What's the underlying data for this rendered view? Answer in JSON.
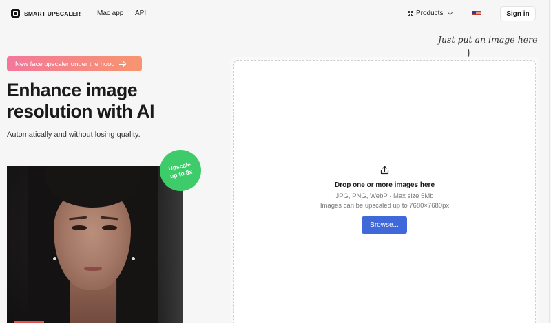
{
  "header": {
    "logo_text": "SMART UPSCALER",
    "nav": {
      "mac_app": "Mac app",
      "api": "API"
    },
    "products_label": "Products",
    "language_flag": "us-flag",
    "sign_in_label": "Sign in"
  },
  "hero": {
    "badge_text": "New face upscaler under the hood",
    "headline": "Enhance image resolution with AI",
    "subhead": "Automatically and without losing quality.",
    "stamp_text": "Upscale up to 8x"
  },
  "dropzone": {
    "hint": "Just put an image here",
    "title": "Drop one or more images here",
    "formats": "JPG, PNG, WebP · Max size 5Mb",
    "limit": "Images can be upscaled up to 7680×7680px",
    "browse_label": "Browse..."
  },
  "colors": {
    "accent_blue": "#3f68d9",
    "badge_gradient_start": "#f2789a",
    "badge_gradient_end": "#f7956f",
    "stamp_green": "#3ecb69"
  },
  "icons": {
    "logo": "logo-mark-icon",
    "products": "grid-icon",
    "dropdown": "chevron-down-icon",
    "badge_arrow": "arrow-right-icon",
    "upload": "upload-icon",
    "hint_arrow": "curved-arrow-down-icon"
  }
}
